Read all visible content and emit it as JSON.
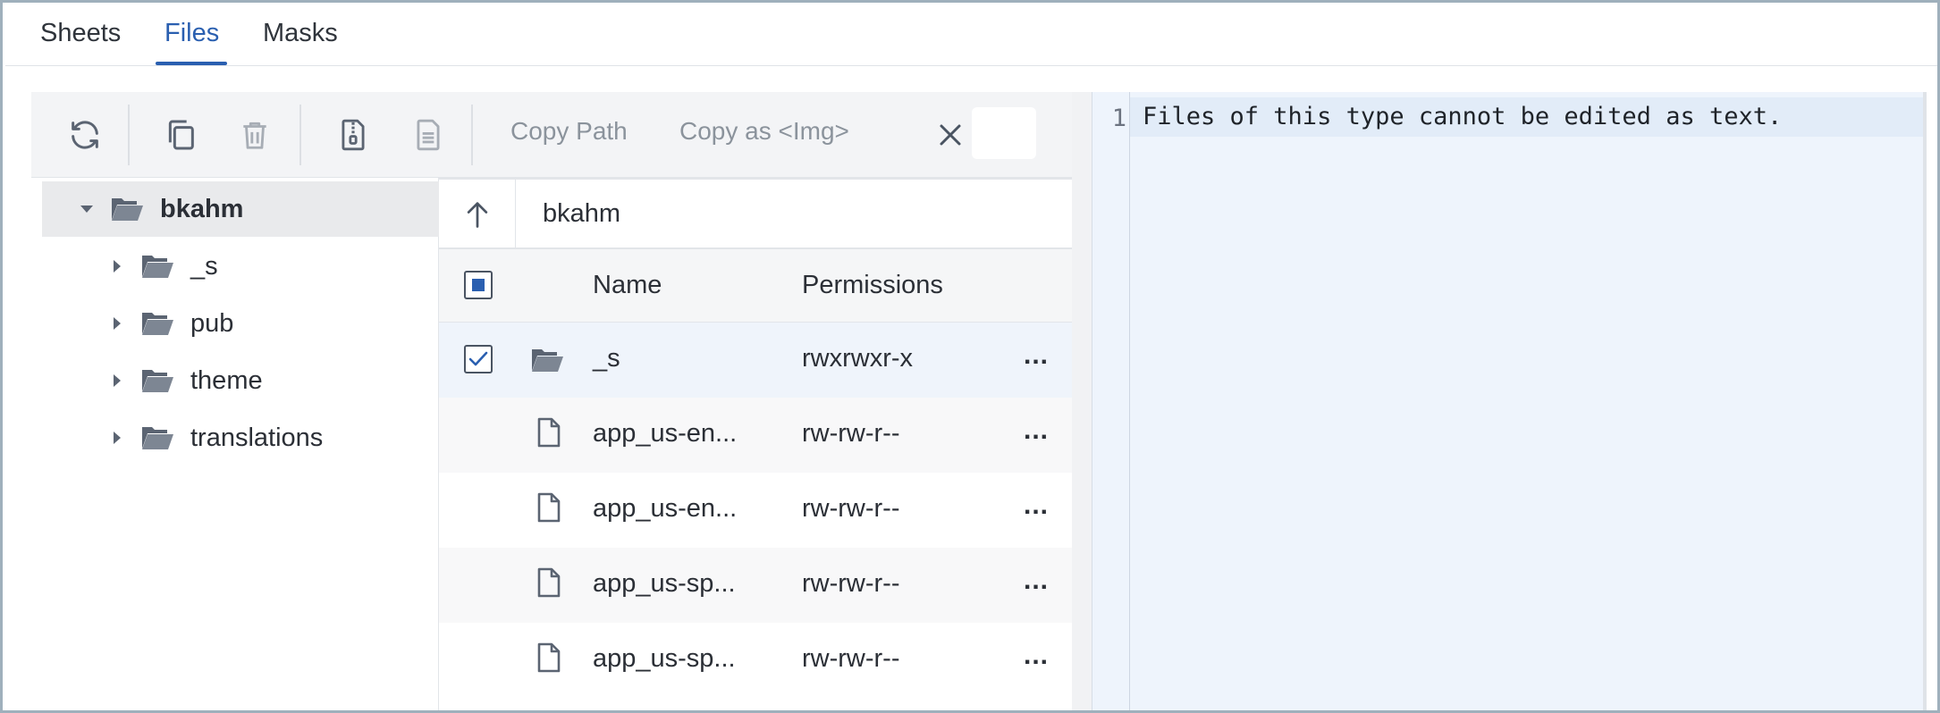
{
  "tabs": [
    {
      "label": "Sheets"
    },
    {
      "label": "Files",
      "active": true
    },
    {
      "label": "Masks"
    }
  ],
  "toolbar": {
    "refresh_icon": "refresh-icon",
    "copy_icon": "copy-icon",
    "delete_icon": "trash-icon",
    "archive_icon": "zip-file-icon",
    "document_icon": "document-icon",
    "copy_path_label": "Copy Path",
    "copy_img_label": "Copy as <Img>",
    "close_icon": "close-icon"
  },
  "tree": {
    "root": {
      "label": "bkahm",
      "expanded": true
    },
    "children": [
      {
        "label": "_s"
      },
      {
        "label": "pub"
      },
      {
        "label": "theme"
      },
      {
        "label": "translations"
      }
    ]
  },
  "file_list": {
    "current_path": "bkahm",
    "columns": {
      "name": "Name",
      "permissions": "Permissions"
    },
    "rows": [
      {
        "type": "folder",
        "name": "_s",
        "permissions": "rwxrwxr-x",
        "selected": true
      },
      {
        "type": "file",
        "name": "app_us-en...",
        "permissions": "rw-rw-r--",
        "selected": false
      },
      {
        "type": "file",
        "name": "app_us-en...",
        "permissions": "rw-rw-r--",
        "selected": false
      },
      {
        "type": "file",
        "name": "app_us-sp...",
        "permissions": "rw-rw-r--",
        "selected": false
      },
      {
        "type": "file",
        "name": "app_us-sp...",
        "permissions": "rw-rw-r--",
        "selected": false
      }
    ],
    "more_label": "..."
  },
  "editor": {
    "line_number": "1",
    "text": "Files of this type cannot be edited as text."
  },
  "colors": {
    "accent": "#2a5fb0",
    "editor_bg": "#eef4fc",
    "selected_row": "#eff4fb"
  }
}
